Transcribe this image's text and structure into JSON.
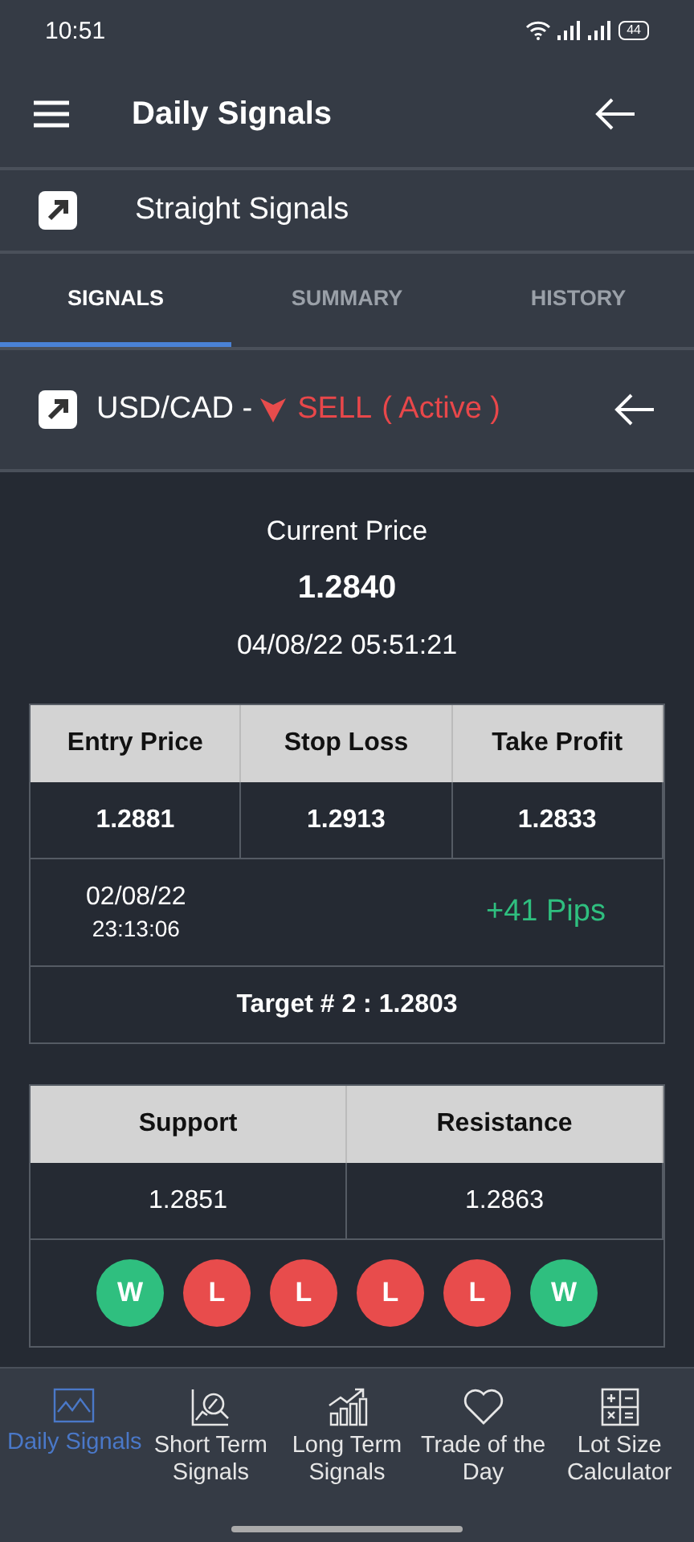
{
  "status_bar": {
    "time": "10:51",
    "battery": "44"
  },
  "header": {
    "title": "Daily Signals"
  },
  "category": {
    "label": "Straight Signals"
  },
  "tabs": [
    {
      "label": "SIGNALS",
      "selected": true
    },
    {
      "label": "SUMMARY",
      "selected": false
    },
    {
      "label": "HISTORY",
      "selected": false
    }
  ],
  "signal": {
    "pair": "USD/CAD -",
    "direction": "SELL",
    "status": "( Active )"
  },
  "current": {
    "label": "Current Price",
    "price": "1.2840",
    "datetime": "04/08/22 05:51:21"
  },
  "trade_table": {
    "columns": [
      "Entry Price",
      "Stop Loss",
      "Take Profit"
    ],
    "values": [
      "1.2881",
      "1.2913",
      "1.2833"
    ],
    "date": "02/08/22",
    "time": "23:13:06",
    "pips": "+41 Pips",
    "target": "Target # 2 : 1.2803"
  },
  "levels_table": {
    "columns": [
      "Support",
      "Resistance"
    ],
    "values": [
      "1.2851",
      "1.2863"
    ]
  },
  "results": [
    {
      "label": "W",
      "color": "#2fbf7f"
    },
    {
      "label": "L",
      "color": "#e84c4c"
    },
    {
      "label": "L",
      "color": "#e84c4c"
    },
    {
      "label": "L",
      "color": "#e84c4c"
    },
    {
      "label": "L",
      "color": "#e84c4c"
    },
    {
      "label": "W",
      "color": "#2fbf7f"
    }
  ],
  "bottom_nav": [
    {
      "kind": "chart",
      "label": "Daily Signals",
      "selected": true
    },
    {
      "kind": "analysis",
      "label": "Short Term Signals",
      "selected": false
    },
    {
      "kind": "growth",
      "label": "Long Term Signals",
      "selected": false
    },
    {
      "kind": "heart",
      "label": "Trade of the Day",
      "selected": false
    },
    {
      "kind": "calculator",
      "label": "Lot Size Calculator",
      "selected": false
    }
  ]
}
